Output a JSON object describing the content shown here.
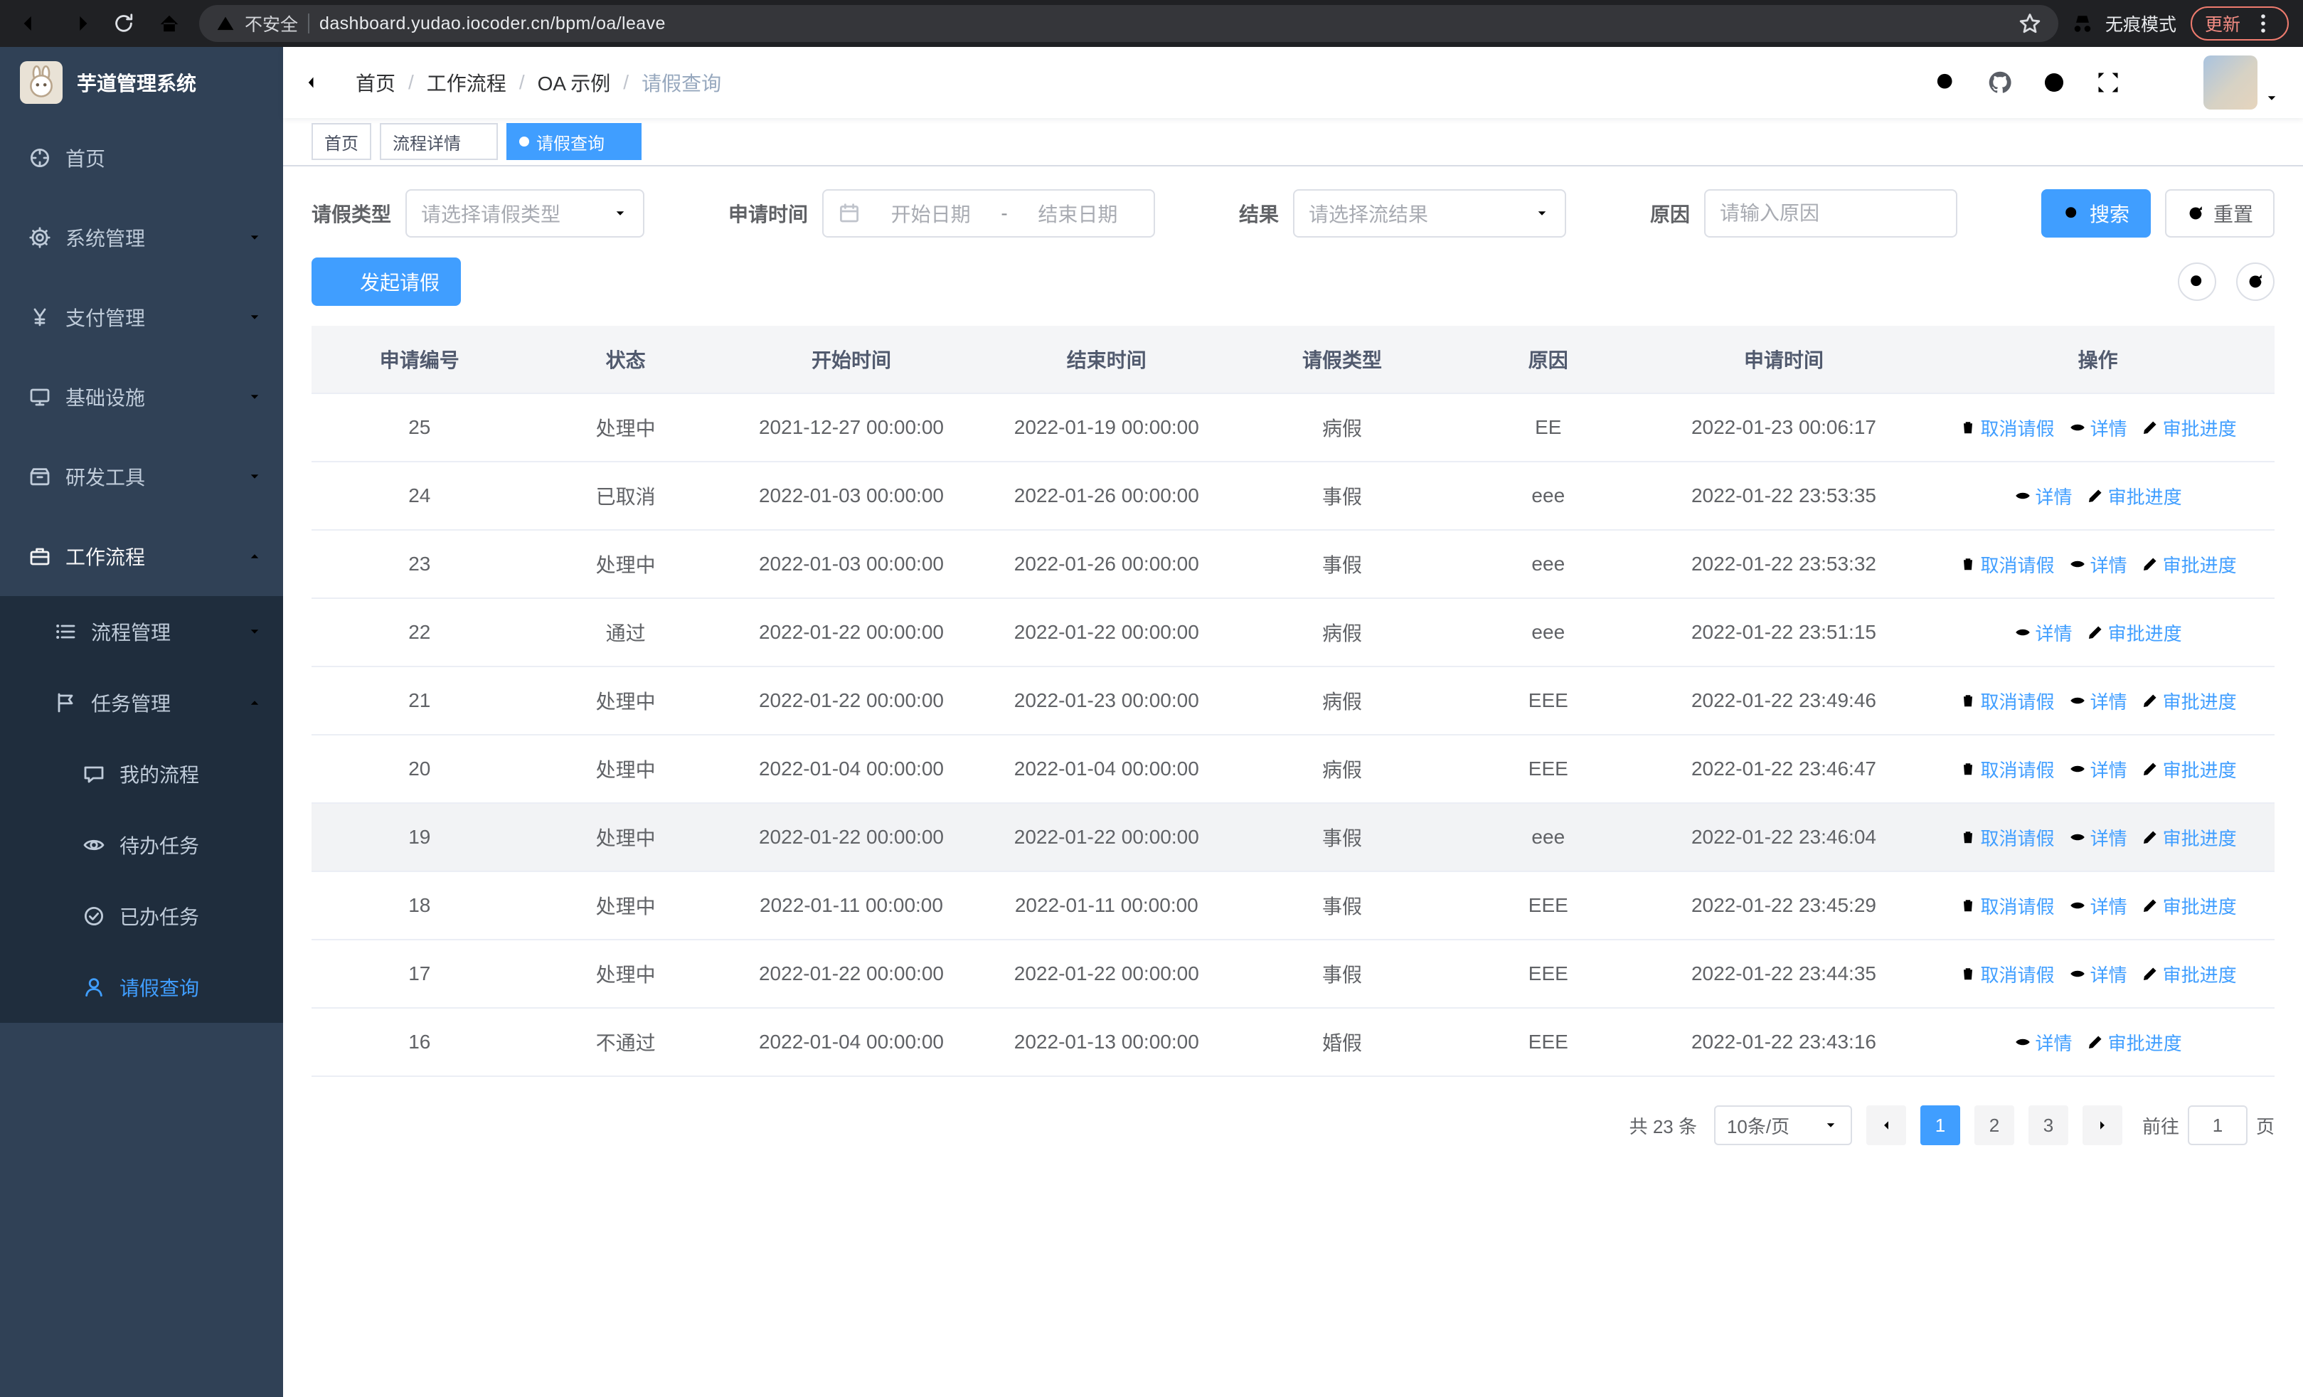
{
  "browser": {
    "security_label": "不安全",
    "url": "dashboard.yudao.iocoder.cn/bpm/oa/leave",
    "incognito_label": "无痕模式",
    "update_label": "更新"
  },
  "sidebar": {
    "logo_title": "芋道管理系统",
    "items": [
      {
        "label": "首页",
        "icon": "dashboard-icon"
      },
      {
        "label": "系统管理",
        "icon": "gear-icon"
      },
      {
        "label": "支付管理",
        "icon": "yen-icon"
      },
      {
        "label": "基础设施",
        "icon": "monitor-icon"
      },
      {
        "label": "研发工具",
        "icon": "toolbox-icon"
      },
      {
        "label": "工作流程",
        "icon": "briefcase-icon"
      },
      {
        "label": "流程管理",
        "icon": "list-icon"
      },
      {
        "label": "任务管理",
        "icon": "flag-icon"
      },
      {
        "label": "我的流程",
        "icon": "chat-icon"
      },
      {
        "label": "待办任务",
        "icon": "eye-icon"
      },
      {
        "label": "已办任务",
        "icon": "check-badge-icon"
      },
      {
        "label": "请假查询",
        "icon": "user-icon"
      }
    ]
  },
  "header": {
    "breadcrumb": [
      "首页",
      "工作流程",
      "OA 示例",
      "请假查询"
    ]
  },
  "tags": [
    {
      "label": "首页"
    },
    {
      "label": "流程详情"
    },
    {
      "label": "请假查询"
    }
  ],
  "filters": {
    "leave_type_label": "请假类型",
    "leave_type_placeholder": "请选择请假类型",
    "apply_time_label": "申请时间",
    "start_date_placeholder": "开始日期",
    "range_separator": "-",
    "end_date_placeholder": "结束日期",
    "result_label": "结果",
    "result_placeholder": "请选择流结果",
    "reason_label": "原因",
    "reason_placeholder": "请输入原因",
    "search_button": "搜索",
    "reset_button": "重置"
  },
  "toolbar": {
    "create_button": "发起请假"
  },
  "table": {
    "columns": [
      "申请编号",
      "状态",
      "开始时间",
      "结束时间",
      "请假类型",
      "原因",
      "申请时间",
      "操作"
    ],
    "actions": {
      "cancel": "取消请假",
      "detail": "详情",
      "progress": "审批进度"
    },
    "rows": [
      {
        "id": "25",
        "status": "处理中",
        "start": "2021-12-27 00:00:00",
        "end": "2022-01-19 00:00:00",
        "type": "病假",
        "reason": "EE",
        "apply": "2022-01-23 00:06:17",
        "cancelable": true,
        "highlight": false
      },
      {
        "id": "24",
        "status": "已取消",
        "start": "2022-01-03 00:00:00",
        "end": "2022-01-26 00:00:00",
        "type": "事假",
        "reason": "eee",
        "apply": "2022-01-22 23:53:35",
        "cancelable": false,
        "highlight": false
      },
      {
        "id": "23",
        "status": "处理中",
        "start": "2022-01-03 00:00:00",
        "end": "2022-01-26 00:00:00",
        "type": "事假",
        "reason": "eee",
        "apply": "2022-01-22 23:53:32",
        "cancelable": true,
        "highlight": false
      },
      {
        "id": "22",
        "status": "通过",
        "start": "2022-01-22 00:00:00",
        "end": "2022-01-22 00:00:00",
        "type": "病假",
        "reason": "eee",
        "apply": "2022-01-22 23:51:15",
        "cancelable": false,
        "highlight": false
      },
      {
        "id": "21",
        "status": "处理中",
        "start": "2022-01-22 00:00:00",
        "end": "2022-01-23 00:00:00",
        "type": "病假",
        "reason": "EEE",
        "apply": "2022-01-22 23:49:46",
        "cancelable": true,
        "highlight": false
      },
      {
        "id": "20",
        "status": "处理中",
        "start": "2022-01-04 00:00:00",
        "end": "2022-01-04 00:00:00",
        "type": "病假",
        "reason": "EEE",
        "apply": "2022-01-22 23:46:47",
        "cancelable": true,
        "highlight": false
      },
      {
        "id": "19",
        "status": "处理中",
        "start": "2022-01-22 00:00:00",
        "end": "2022-01-22 00:00:00",
        "type": "事假",
        "reason": "eee",
        "apply": "2022-01-22 23:46:04",
        "cancelable": true,
        "highlight": true
      },
      {
        "id": "18",
        "status": "处理中",
        "start": "2022-01-11 00:00:00",
        "end": "2022-01-11 00:00:00",
        "type": "事假",
        "reason": "EEE",
        "apply": "2022-01-22 23:45:29",
        "cancelable": true,
        "highlight": false
      },
      {
        "id": "17",
        "status": "处理中",
        "start": "2022-01-22 00:00:00",
        "end": "2022-01-22 00:00:00",
        "type": "事假",
        "reason": "EEE",
        "apply": "2022-01-22 23:44:35",
        "cancelable": true,
        "highlight": false
      },
      {
        "id": "16",
        "status": "不通过",
        "start": "2022-01-04 00:00:00",
        "end": "2022-01-13 00:00:00",
        "type": "婚假",
        "reason": "EEE",
        "apply": "2022-01-22 23:43:16",
        "cancelable": false,
        "highlight": false
      }
    ]
  },
  "pagination": {
    "total": "共 23 条",
    "page_size": "10条/页",
    "pages": [
      "1",
      "2",
      "3"
    ],
    "active_page": "1",
    "goto_label": "前往",
    "goto_value": "1",
    "page_unit": "页"
  }
}
